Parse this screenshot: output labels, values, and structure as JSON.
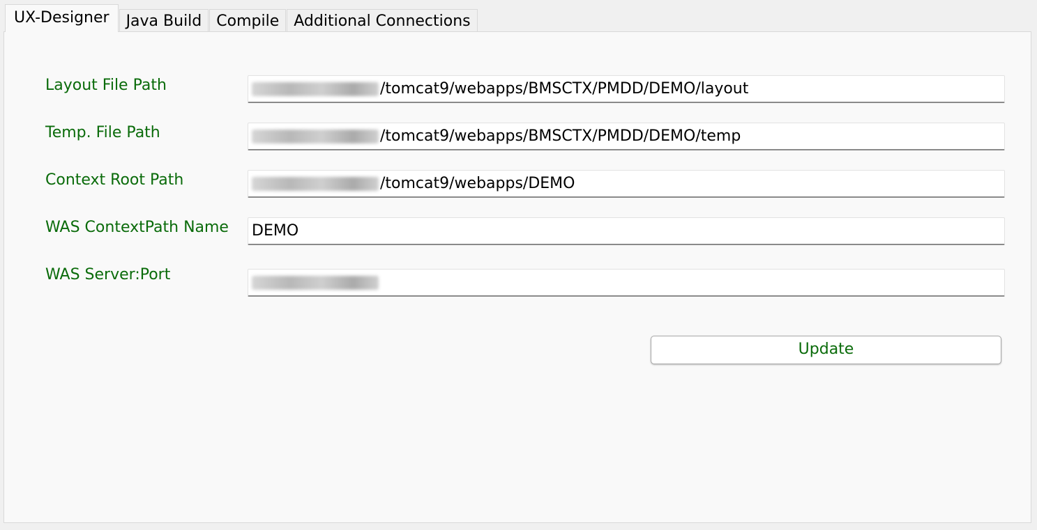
{
  "tabs": [
    {
      "label": "UX-Designer",
      "active": true
    },
    {
      "label": "Java Build",
      "active": false
    },
    {
      "label": "Compile",
      "active": false
    },
    {
      "label": "Additional Connections",
      "active": false
    }
  ],
  "form": {
    "layout_path": {
      "label": "Layout File Path",
      "value": "/tomcat9/webapps/BMSCTX/PMDD/DEMO/layout"
    },
    "temp_path": {
      "label": "Temp. File Path",
      "value": "/tomcat9/webapps/BMSCTX/PMDD/DEMO/temp"
    },
    "context_root": {
      "label": "Context Root Path",
      "value": "/tomcat9/webapps/DEMO"
    },
    "context_name": {
      "label": "WAS ContextPath Name",
      "value": "DEMO"
    },
    "server_port": {
      "label": "WAS Server:Port",
      "value": ""
    }
  },
  "update_label": "Update",
  "colors": {
    "label_green": "#0a6b0a",
    "panel_bg": "#f9f9f9"
  }
}
